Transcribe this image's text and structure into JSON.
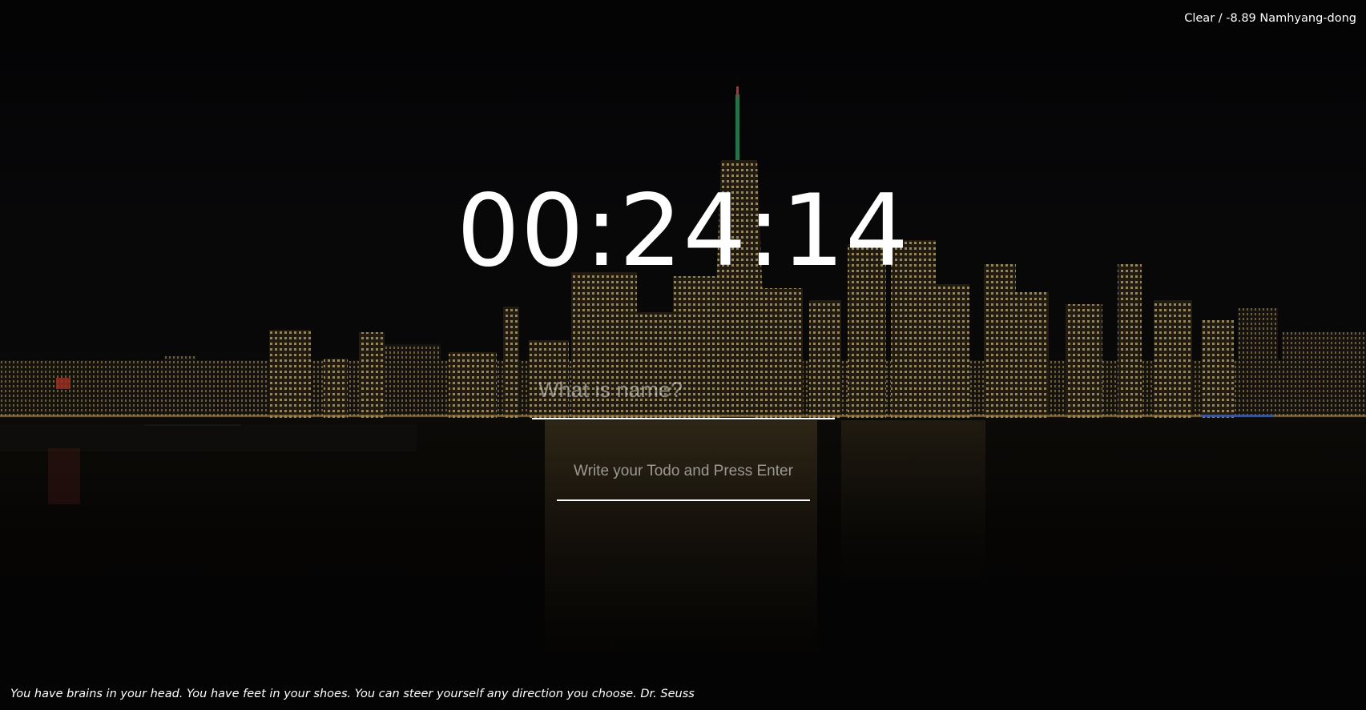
{
  "weather": {
    "text": "Clear / -8.89 Namhyang-dong"
  },
  "clock": {
    "time": "00:24:14"
  },
  "name_input": {
    "placeholder": "What is name?"
  },
  "todo_input": {
    "placeholder": "Write your Todo and Press Enter"
  },
  "quote": {
    "text": "You have brains in your head. You have feet in your shoes. You can steer yourself any direction you choose. Dr. Seuss"
  }
}
